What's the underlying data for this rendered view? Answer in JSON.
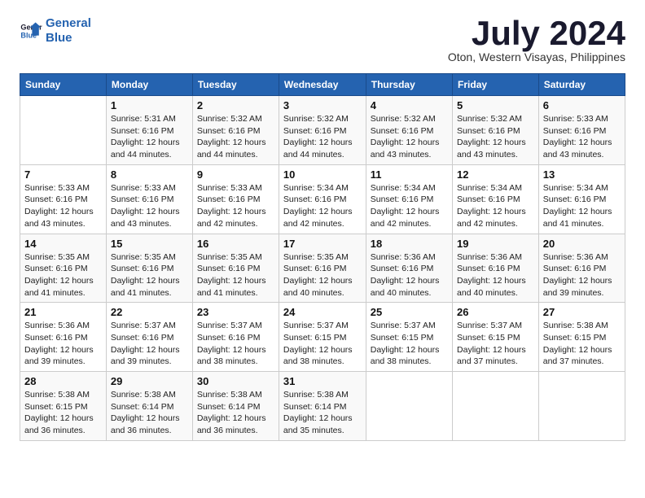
{
  "header": {
    "logo_line1": "General",
    "logo_line2": "Blue",
    "month": "July 2024",
    "location": "Oton, Western Visayas, Philippines"
  },
  "days_of_week": [
    "Sunday",
    "Monday",
    "Tuesday",
    "Wednesday",
    "Thursday",
    "Friday",
    "Saturday"
  ],
  "weeks": [
    [
      {
        "day": "",
        "info": ""
      },
      {
        "day": "1",
        "info": "Sunrise: 5:31 AM\nSunset: 6:16 PM\nDaylight: 12 hours\nand 44 minutes."
      },
      {
        "day": "2",
        "info": "Sunrise: 5:32 AM\nSunset: 6:16 PM\nDaylight: 12 hours\nand 44 minutes."
      },
      {
        "day": "3",
        "info": "Sunrise: 5:32 AM\nSunset: 6:16 PM\nDaylight: 12 hours\nand 44 minutes."
      },
      {
        "day": "4",
        "info": "Sunrise: 5:32 AM\nSunset: 6:16 PM\nDaylight: 12 hours\nand 43 minutes."
      },
      {
        "day": "5",
        "info": "Sunrise: 5:32 AM\nSunset: 6:16 PM\nDaylight: 12 hours\nand 43 minutes."
      },
      {
        "day": "6",
        "info": "Sunrise: 5:33 AM\nSunset: 6:16 PM\nDaylight: 12 hours\nand 43 minutes."
      }
    ],
    [
      {
        "day": "7",
        "info": "Sunrise: 5:33 AM\nSunset: 6:16 PM\nDaylight: 12 hours\nand 43 minutes."
      },
      {
        "day": "8",
        "info": "Sunrise: 5:33 AM\nSunset: 6:16 PM\nDaylight: 12 hours\nand 43 minutes."
      },
      {
        "day": "9",
        "info": "Sunrise: 5:33 AM\nSunset: 6:16 PM\nDaylight: 12 hours\nand 42 minutes."
      },
      {
        "day": "10",
        "info": "Sunrise: 5:34 AM\nSunset: 6:16 PM\nDaylight: 12 hours\nand 42 minutes."
      },
      {
        "day": "11",
        "info": "Sunrise: 5:34 AM\nSunset: 6:16 PM\nDaylight: 12 hours\nand 42 minutes."
      },
      {
        "day": "12",
        "info": "Sunrise: 5:34 AM\nSunset: 6:16 PM\nDaylight: 12 hours\nand 42 minutes."
      },
      {
        "day": "13",
        "info": "Sunrise: 5:34 AM\nSunset: 6:16 PM\nDaylight: 12 hours\nand 41 minutes."
      }
    ],
    [
      {
        "day": "14",
        "info": "Sunrise: 5:35 AM\nSunset: 6:16 PM\nDaylight: 12 hours\nand 41 minutes."
      },
      {
        "day": "15",
        "info": "Sunrise: 5:35 AM\nSunset: 6:16 PM\nDaylight: 12 hours\nand 41 minutes."
      },
      {
        "day": "16",
        "info": "Sunrise: 5:35 AM\nSunset: 6:16 PM\nDaylight: 12 hours\nand 41 minutes."
      },
      {
        "day": "17",
        "info": "Sunrise: 5:35 AM\nSunset: 6:16 PM\nDaylight: 12 hours\nand 40 minutes."
      },
      {
        "day": "18",
        "info": "Sunrise: 5:36 AM\nSunset: 6:16 PM\nDaylight: 12 hours\nand 40 minutes."
      },
      {
        "day": "19",
        "info": "Sunrise: 5:36 AM\nSunset: 6:16 PM\nDaylight: 12 hours\nand 40 minutes."
      },
      {
        "day": "20",
        "info": "Sunrise: 5:36 AM\nSunset: 6:16 PM\nDaylight: 12 hours\nand 39 minutes."
      }
    ],
    [
      {
        "day": "21",
        "info": "Sunrise: 5:36 AM\nSunset: 6:16 PM\nDaylight: 12 hours\nand 39 minutes."
      },
      {
        "day": "22",
        "info": "Sunrise: 5:37 AM\nSunset: 6:16 PM\nDaylight: 12 hours\nand 39 minutes."
      },
      {
        "day": "23",
        "info": "Sunrise: 5:37 AM\nSunset: 6:16 PM\nDaylight: 12 hours\nand 38 minutes."
      },
      {
        "day": "24",
        "info": "Sunrise: 5:37 AM\nSunset: 6:15 PM\nDaylight: 12 hours\nand 38 minutes."
      },
      {
        "day": "25",
        "info": "Sunrise: 5:37 AM\nSunset: 6:15 PM\nDaylight: 12 hours\nand 38 minutes."
      },
      {
        "day": "26",
        "info": "Sunrise: 5:37 AM\nSunset: 6:15 PM\nDaylight: 12 hours\nand 37 minutes."
      },
      {
        "day": "27",
        "info": "Sunrise: 5:38 AM\nSunset: 6:15 PM\nDaylight: 12 hours\nand 37 minutes."
      }
    ],
    [
      {
        "day": "28",
        "info": "Sunrise: 5:38 AM\nSunset: 6:15 PM\nDaylight: 12 hours\nand 36 minutes."
      },
      {
        "day": "29",
        "info": "Sunrise: 5:38 AM\nSunset: 6:14 PM\nDaylight: 12 hours\nand 36 minutes."
      },
      {
        "day": "30",
        "info": "Sunrise: 5:38 AM\nSunset: 6:14 PM\nDaylight: 12 hours\nand 36 minutes."
      },
      {
        "day": "31",
        "info": "Sunrise: 5:38 AM\nSunset: 6:14 PM\nDaylight: 12 hours\nand 35 minutes."
      },
      {
        "day": "",
        "info": ""
      },
      {
        "day": "",
        "info": ""
      },
      {
        "day": "",
        "info": ""
      }
    ]
  ]
}
